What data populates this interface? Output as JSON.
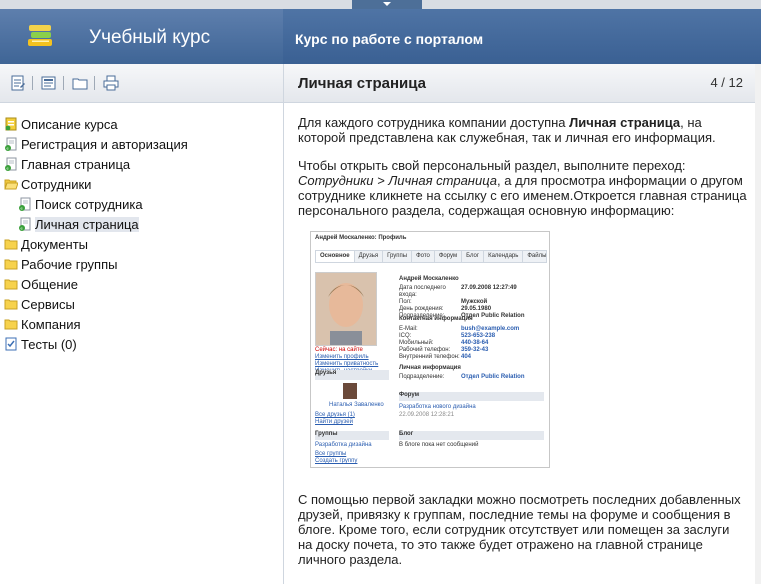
{
  "header": {
    "app_title": "Учебный курс",
    "course_title": "Курс по работе с порталом"
  },
  "sidebar": {
    "toolbar_icons": [
      "notes-icon",
      "print-preview-icon",
      "folder-icon",
      "printer-icon"
    ],
    "tree": [
      {
        "label": "Описание курса",
        "icon": "course-doc-icon",
        "indent": 0
      },
      {
        "label": "Регистрация и авторизация",
        "icon": "lesson-icon",
        "indent": 0
      },
      {
        "label": "Главная страница",
        "icon": "lesson-icon",
        "indent": 0
      },
      {
        "label": "Сотрудники",
        "icon": "folder-open-icon",
        "indent": 0
      },
      {
        "label": "Поиск сотрудника",
        "icon": "lesson-icon",
        "indent": 1
      },
      {
        "label": "Личная страница",
        "icon": "lesson-icon",
        "indent": 1,
        "selected": true
      },
      {
        "label": "Документы",
        "icon": "folder-icon",
        "indent": 0
      },
      {
        "label": "Рабочие группы",
        "icon": "folder-icon",
        "indent": 0
      },
      {
        "label": "Общение",
        "icon": "folder-icon",
        "indent": 0
      },
      {
        "label": "Сервисы",
        "icon": "folder-icon",
        "indent": 0
      },
      {
        "label": "Компания",
        "icon": "folder-icon",
        "indent": 0
      },
      {
        "label": "Тесты (0)",
        "icon": "test-icon",
        "indent": 0
      }
    ]
  },
  "main": {
    "page_title": "Личная страница",
    "page_counter": "4 / 12",
    "para1_before": "Для каждого сотрудника компании доступна ",
    "para1_bold": "Личная страница",
    "para1_after": ", на которой представлена как служебная, так и личная его информация.",
    "para2_before": "Чтобы открыть свой персональный раздел, выполните переход: ",
    "para2_italic": "Сотрудники > Личная страница",
    "para2_after": ", а для просмотра информации о другом сотруднике кликнете на ссылку с его именем.Откроется главная страница персонального раздела, содержащая основную информацию:",
    "para3": "С помощью первой закладки можно посмотреть последних добавленных друзей, привязку к группам, последние темы на форуме и сообщения в блоге. Кроме того, если сотрудник отсутствует или помещен за заслуги на доску почета, то это также будет отражено на главной странице личного раздела."
  },
  "screenshot": {
    "title": "Андрей Москаленко: Профиль",
    "tabs": [
      "Основное",
      "Друзья",
      "Группы",
      "Фото",
      "Форум",
      "Блог",
      "Календарь",
      "Файлы"
    ],
    "name": "Андрей Москаленко",
    "info": [
      [
        "Дата последнего входа:",
        "27.09.2008 12:27:49"
      ],
      [
        "Пол:",
        "Мужской"
      ],
      [
        "День рождения:",
        "29.05.1980"
      ],
      [
        "Подразделение:",
        "Отдел Public Relation"
      ]
    ],
    "contacts_title": "Контактная информация",
    "contacts": [
      [
        "E-Mail:",
        "bush@example.com"
      ],
      [
        "ICQ:",
        "523-653-238"
      ],
      [
        "Мобильный:",
        "440-38-64"
      ],
      [
        "Рабочий телефон:",
        "359-32-43"
      ],
      [
        "Внутренний телефон:",
        "404"
      ]
    ],
    "personal_title": "Личная информация",
    "personal": [
      [
        "Подразделение:",
        "Отдел Public Relation"
      ]
    ],
    "status": "Сейчас: на сайте",
    "links": [
      "Изменить профиль",
      "Изменить приватность",
      "Изменить настройки"
    ],
    "friends_title": "Друзья",
    "friend_name": "Наталья Заваленко",
    "friends_links": [
      "Все друзья (1)",
      "Найти друзей"
    ],
    "groups_title": "Группы",
    "groups_item": "Разработка дизайна",
    "groups_links": [
      "Все группы",
      "Создать группу"
    ],
    "forum_title": "Форум",
    "forum_item": "Разработка нового дизайна",
    "forum_meta": "22.09.2008 12:28:21",
    "blog_title": "Блог",
    "blog_text": "В блоге пока нет сообщений"
  }
}
